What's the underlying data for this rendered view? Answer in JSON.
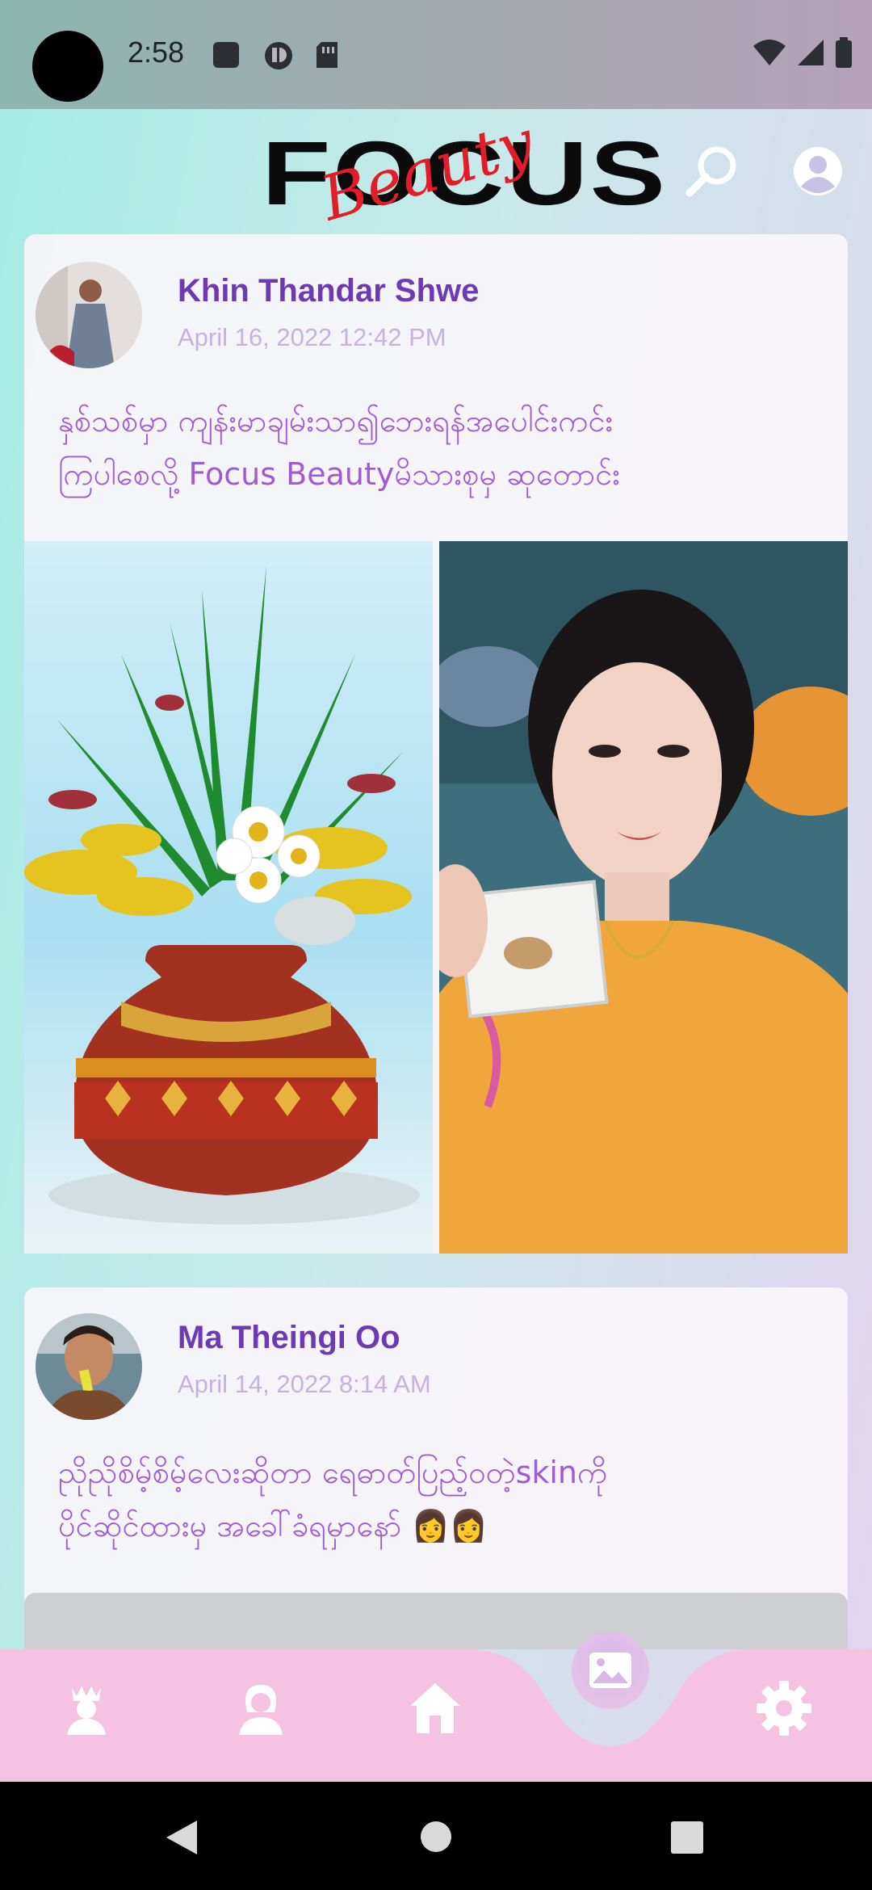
{
  "status_bar": {
    "time": "2:58",
    "icons": [
      "sd-card-icon",
      "app-icon",
      "sim-icon",
      "wifi-icon",
      "signal-icon",
      "battery-icon"
    ]
  },
  "header": {
    "logo_focus": "FOCUS",
    "logo_beauty": "Beauty",
    "search_icon": "search-icon",
    "account_icon": "account-circle-icon"
  },
  "posts": [
    {
      "author": "Khin Thandar Shwe",
      "date": "April 16, 2022 12:42 PM",
      "caption_line1": "နှစ်သစ်မှာ ကျန်းမာချမ်းသာ၍ဘေးရန်အပေါင်းကင်း",
      "caption_line2": "ကြပါစေလို့ Focus Beautyမိသားစုမှ ဆုတောင်း"
    },
    {
      "author": "Ma Theingi Oo",
      "date": "April 14, 2022 8:14 AM",
      "caption_line1": "ညိုညိုစိမ့်စိမ့်လေးဆိုတာ ရေဓာတ်ပြည့်ဝတဲ့skinကို",
      "caption_line2": "ပိုင်ဆိုင်ထားမှ အခေါ်ခံရမှာနော် 👩👩"
    }
  ],
  "bottom_nav": {
    "items": [
      "queen-icon",
      "profile-icon",
      "home-icon",
      "gallery-icon",
      "settings-icon"
    ]
  },
  "colors": {
    "author": "#6d3ab4",
    "caption": "#a15ad6",
    "nav_bg": "#f4c3e1"
  }
}
